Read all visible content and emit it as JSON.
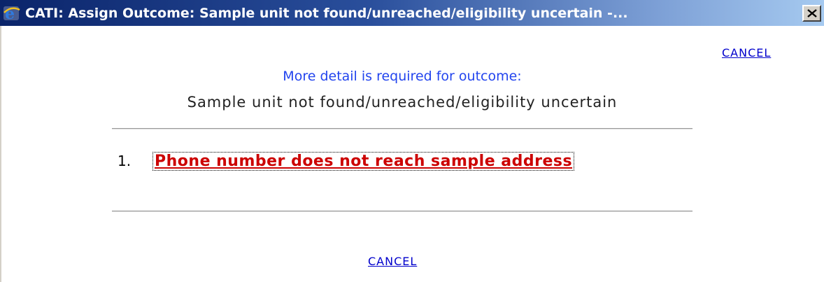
{
  "window": {
    "title": "CATI: Assign Outcome: Sample unit not found/unreached/eligibility uncertain -...",
    "icon": "ie-icon",
    "close_label": "✕"
  },
  "top_link": {
    "label": "CANCEL"
  },
  "prompt": {
    "heading": "More detail is required for outcome:",
    "outcome": "Sample unit not found/unreached/eligibility uncertain"
  },
  "options": [
    {
      "number": "1.",
      "label": "Phone number does not reach sample address"
    }
  ],
  "bottom_link": {
    "label": "CANCEL"
  },
  "colors": {
    "titlebar_start": "#0a246a",
    "titlebar_end": "#a6caf0",
    "link": "#0000cc",
    "heading": "#2244ee",
    "option": "#cc0000"
  }
}
